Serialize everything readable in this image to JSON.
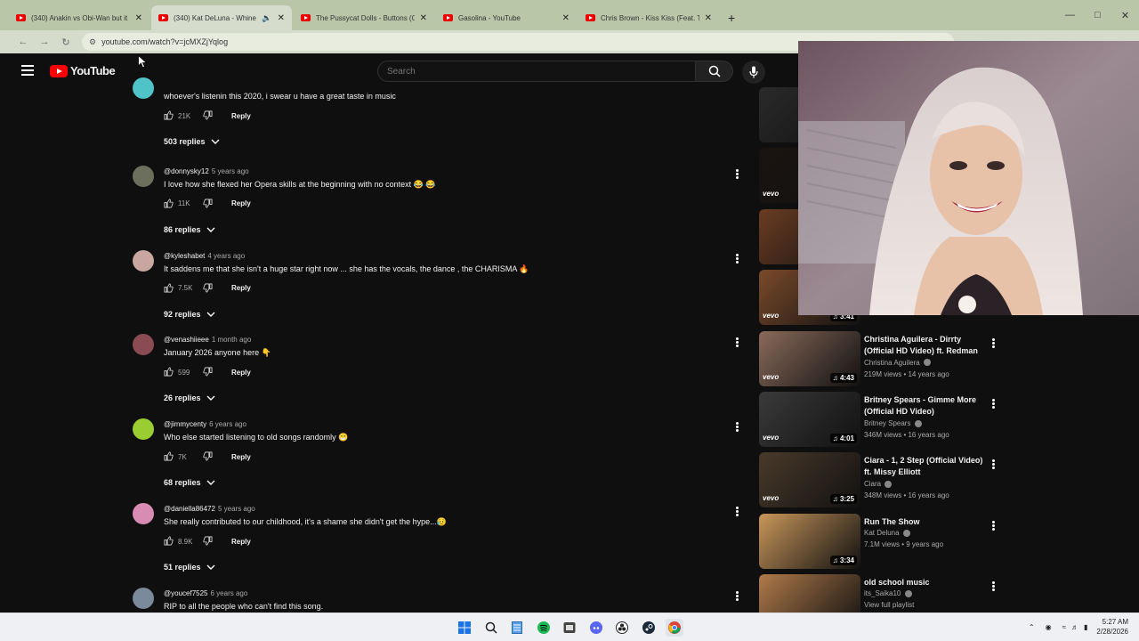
{
  "browser": {
    "tabs": [
      {
        "title": "(340) Anakin vs Obi-Wan but it",
        "active": false
      },
      {
        "title": "(340) Kat DeLuna - Whine Up",
        "active": true
      },
      {
        "title": "The Pussycat Dolls - Buttons (O",
        "active": false
      },
      {
        "title": "Gasolina - YouTube",
        "active": false
      },
      {
        "title": "Chris Brown - Kiss Kiss (Feat. T-",
        "active": false
      }
    ],
    "new_tab": "+",
    "url": "youtube.com/watch?v=jcMXZjYqlog"
  },
  "youtube": {
    "logo_text": "YouTube",
    "search_placeholder": "Search"
  },
  "comments": [
    {
      "author": "",
      "ago": "",
      "text": "whoever's listenin this 2020, i swear u have a great taste in music",
      "likes": "21K",
      "reply": "Reply",
      "replies": "503 replies",
      "avatar_color": "#4fc3c7"
    },
    {
      "author": "@donnysky12",
      "ago": "5 years ago",
      "text": "I love how she flexed her Opera skills at the beginning with no context 😂 😂",
      "likes": "11K",
      "reply": "Reply",
      "replies": "86 replies",
      "avatar_color": "#6b6f5c"
    },
    {
      "author": "@kyleshabet",
      "ago": "4 years ago",
      "text": "It saddens me that she isn't a huge star right now ... she has the vocals, the dance , the CHARISMA 🔥",
      "likes": "7.5K",
      "reply": "Reply",
      "replies": "92 replies",
      "avatar_color": "#c9a7a0"
    },
    {
      "author": "@venashiieee",
      "ago": "1 month ago",
      "text": "January 2026 anyone here 👇",
      "likes": "599",
      "reply": "Reply",
      "replies": "26 replies",
      "avatar_color": "#8a4b52"
    },
    {
      "author": "@jimmycenty",
      "ago": "6 years ago",
      "text": "Who else started listening to old songs randomly 😁",
      "likes": "7K",
      "reply": "Reply",
      "replies": "68 replies",
      "avatar_color": "#9acd32"
    },
    {
      "author": "@daniella86472",
      "ago": "5 years ago",
      "text": "She really contributed to our childhood, it's a shame she didn't get the hype...😥",
      "likes": "8.9K",
      "reply": "Reply",
      "replies": "51 replies",
      "avatar_color": "#d98cb3"
    },
    {
      "author": "@youcef7525",
      "ago": "6 years ago",
      "text": "RIP to all the people who can't find this song.",
      "likes": "",
      "reply": "",
      "replies": "",
      "avatar_color": "#7a8a9a"
    }
  ],
  "sidebar": [
    {
      "title": "",
      "channel": "",
      "meta": "",
      "duration": "",
      "vevo": "",
      "color": "#2a2a2a"
    },
    {
      "title": "",
      "channel": "",
      "meta": "",
      "duration": "",
      "vevo": "vevo",
      "color": "#1a1410"
    },
    {
      "title": "",
      "channel": "",
      "meta": "",
      "duration": "",
      "vevo": "",
      "color": "#6b3c22"
    },
    {
      "title": "",
      "channel": "",
      "meta": "",
      "duration": "3:41",
      "vevo": "vevo",
      "color": "#7a4a2a"
    },
    {
      "title": "Christina Aguilera - Dirrty (Official HD Video) ft. Redman",
      "channel": "Christina Aguilera",
      "meta": "219M views • 14 years ago",
      "duration": "4:43",
      "vevo": "vevo",
      "color": "#8a6a5a"
    },
    {
      "title": "Britney Spears - Gimme More (Official HD Video)",
      "channel": "Britney Spears",
      "meta": "346M views • 16 years ago",
      "duration": "4:01",
      "vevo": "vevo",
      "color": "#3a3a3a"
    },
    {
      "title": "Ciara - 1, 2 Step (Official Video) ft. Missy Elliott",
      "channel": "Ciara",
      "meta": "348M views • 16 years ago",
      "duration": "3:25",
      "vevo": "vevo",
      "color": "#4a3a2a"
    },
    {
      "title": "Run The Show",
      "channel": "Kat Deluna",
      "meta": "7.1M views • 9 years ago",
      "duration": "3:34",
      "vevo": "",
      "color": "#c8965a"
    },
    {
      "title": "old school music",
      "channel": "its_Saika10",
      "meta": "View full playlist",
      "duration": "",
      "vevo": "",
      "color": "#b07a4a"
    }
  ],
  "taskbar": {
    "time": "5:27 AM",
    "date": "2/28/2026"
  },
  "colors": {
    "youtube_red": "#ff0000",
    "background": "#0f0f0f"
  }
}
